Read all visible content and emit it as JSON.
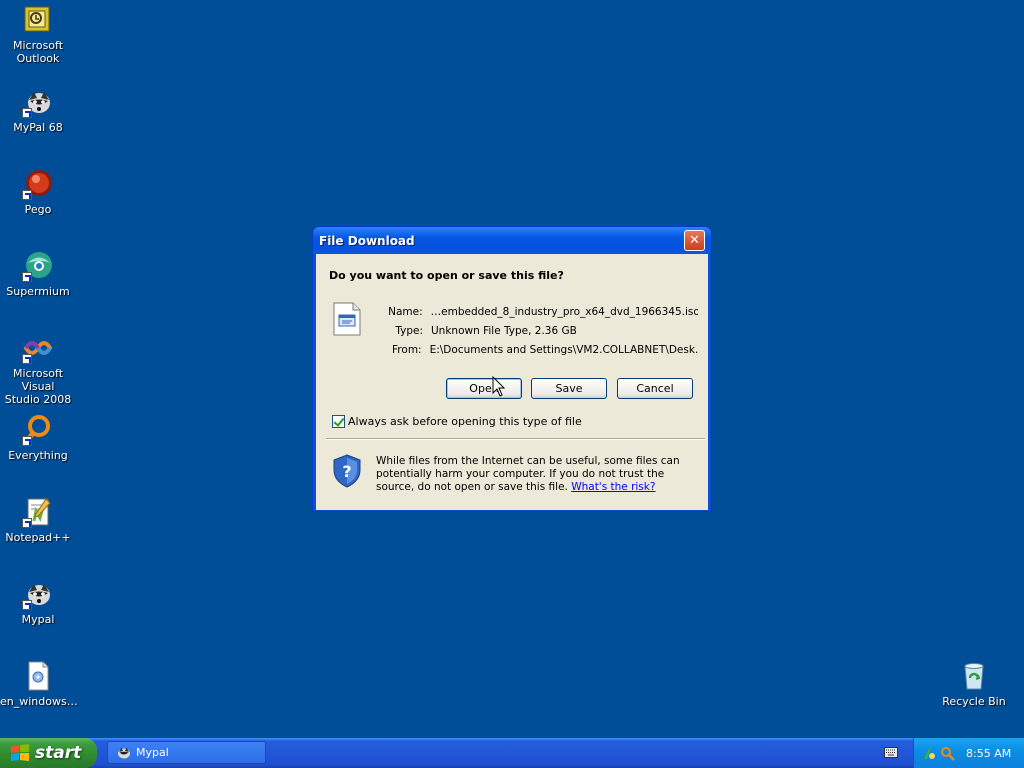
{
  "desktop": {
    "icons": [
      {
        "label_line1": "Microsoft",
        "label_line2": "Outlook",
        "icon": "outlook-icon"
      },
      {
        "label_line1": "MyPal 68",
        "label_line2": "",
        "icon": "raccoon-icon"
      },
      {
        "label_line1": "Pego",
        "label_line2": "",
        "icon": "pego-icon"
      },
      {
        "label_line1": "Supermium",
        "label_line2": "",
        "icon": "supermium-icon"
      },
      {
        "label_line1": "Microsoft Visual",
        "label_line2": "Studio 2008",
        "icon": "visual-studio-icon"
      },
      {
        "label_line1": "Everything",
        "label_line2": "",
        "icon": "everything-icon"
      },
      {
        "label_line1": "Notepad++",
        "label_line2": "",
        "icon": "notepadpp-icon"
      },
      {
        "label_line1": "Mypal",
        "label_line2": "",
        "icon": "raccoon-icon"
      },
      {
        "label_line1": "en_windows…",
        "label_line2": "",
        "icon": "file-icon"
      },
      {
        "label_line1": "Recycle Bin",
        "label_line2": "",
        "icon": "recycle-bin-icon"
      }
    ]
  },
  "dialog": {
    "title": "File Download",
    "question": "Do you want to open or save this file?",
    "name_label": "Name:",
    "name_value": "…embedded_8_industry_pro_x64_dvd_1966345.iso",
    "type_label": "Type:",
    "type_value": "Unknown File Type, 2.36 GB",
    "from_label": "From:",
    "from_value": "E:\\Documents and Settings\\VM2.COLLABNET\\Desk…",
    "open_label": "Open",
    "save_label": "Save",
    "cancel_label": "Cancel",
    "checkbox_label": "Always ask before opening this type of file",
    "checkbox_checked": true,
    "warning_text": "While files from the Internet can be useful, some files can potentially harm your computer. If you do not trust the source, do not open or save this file.",
    "risk_link": "What's the risk?"
  },
  "taskbar": {
    "start_label": "start",
    "task_label": "Mypal",
    "clock": "8:55 AM"
  }
}
